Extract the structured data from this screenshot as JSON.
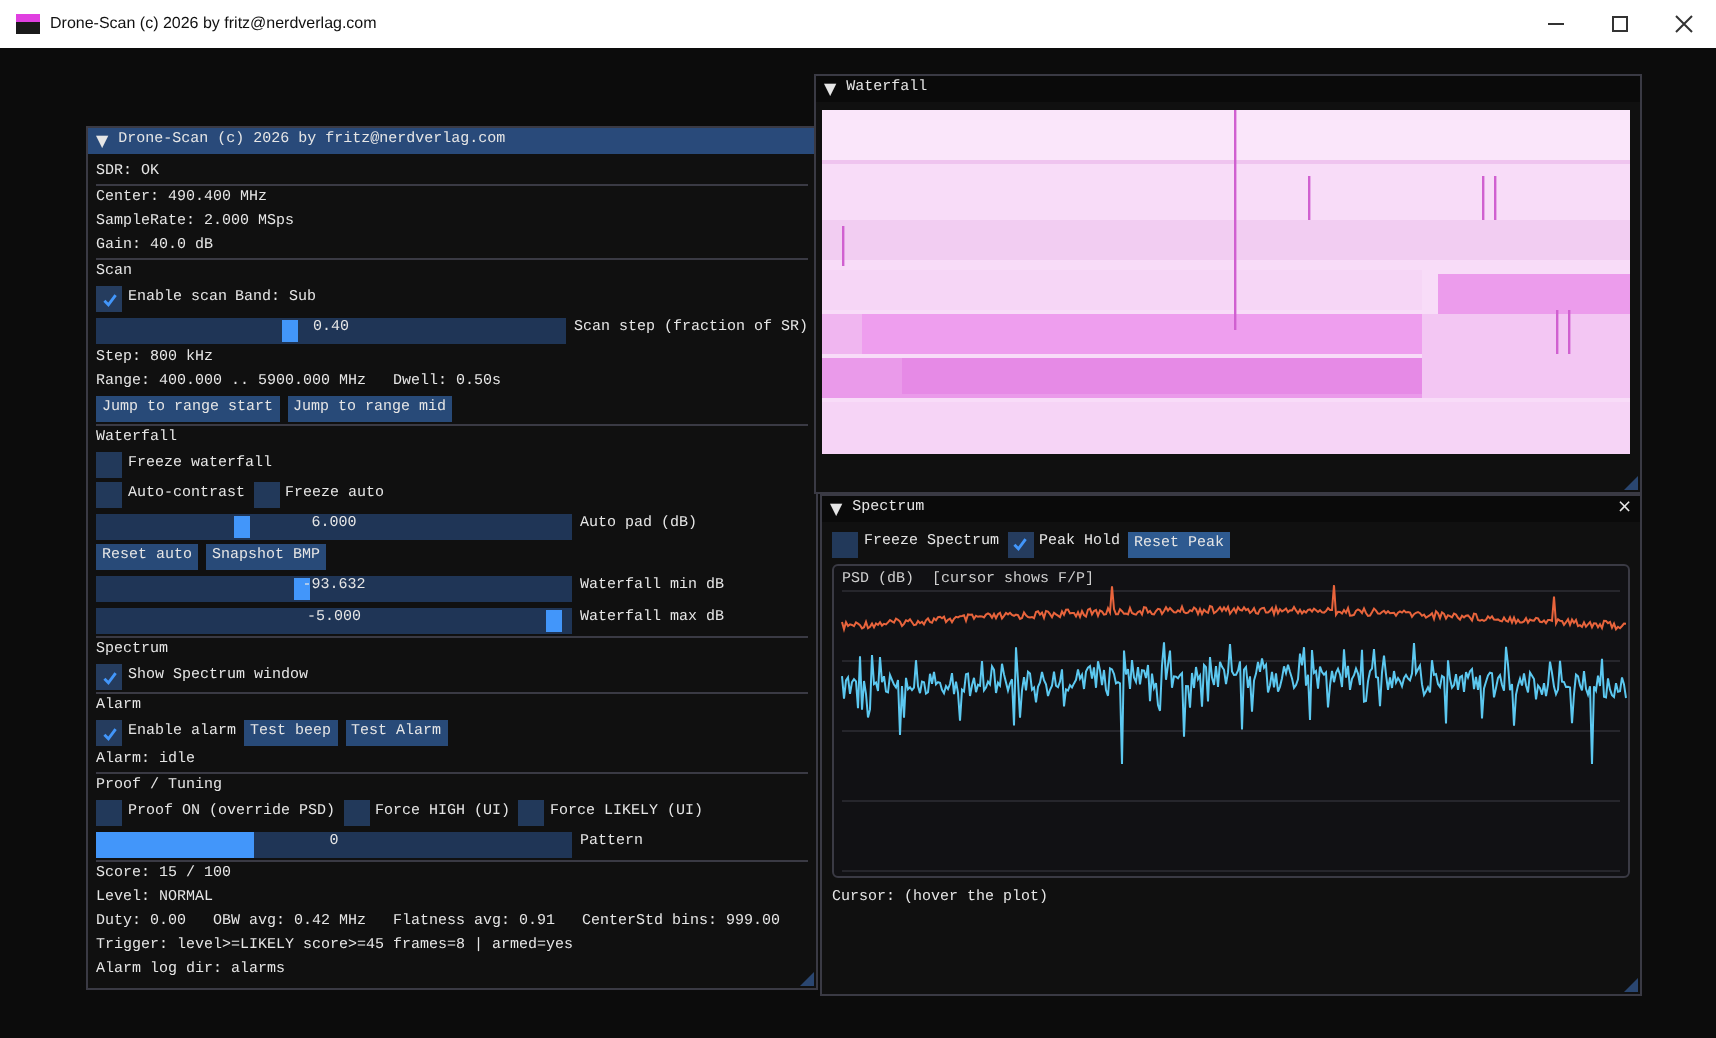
{
  "window": {
    "title": "Drone-Scan (c) 2026 by fritz@nerdverlag.com"
  },
  "control_panel": {
    "arrow": "▼",
    "title": "Drone-Scan (c) 2026 by fritz@nerdverlag.com",
    "items": [
      {
        "kind": "text",
        "text": "SDR: OK"
      },
      {
        "kind": "separator"
      },
      {
        "kind": "text",
        "text": "Center: 490.400 MHz"
      },
      {
        "kind": "text",
        "text": "SampleRate: 2.000 MSps"
      },
      {
        "kind": "text",
        "text": "Gain: 40.0 dB"
      },
      {
        "kind": "separator"
      },
      {
        "kind": "text",
        "text": "Scan"
      },
      {
        "kind": "row",
        "widgets": [
          {
            "kind": "checkbox",
            "label": "Enable scan",
            "checked": true
          },
          {
            "kind": "text",
            "text": "Band: Sub"
          }
        ]
      },
      {
        "kind": "slider",
        "value": "0.40",
        "label": "Scan step (fraction of SR)",
        "level": 0.41
      },
      {
        "kind": "text",
        "text": "Step: 800 kHz"
      },
      {
        "kind": "text",
        "text": "Range: 400.000 .. 5900.000 MHz   Dwell: 0.50s"
      },
      {
        "kind": "row",
        "widgets": [
          {
            "kind": "button",
            "label": "Jump to range start"
          },
          {
            "kind": "button",
            "label": "Jump to range mid"
          }
        ]
      },
      {
        "kind": "separator"
      },
      {
        "kind": "text",
        "text": "Waterfall"
      },
      {
        "kind": "row",
        "widgets": [
          {
            "kind": "checkbox",
            "label": "Freeze waterfall",
            "checked": false
          }
        ]
      },
      {
        "kind": "row",
        "widgets": [
          {
            "kind": "checkbox",
            "label": "Auto-contrast",
            "checked": false
          },
          {
            "kind": "checkbox",
            "label": "Freeze auto",
            "checked": false
          }
        ]
      },
      {
        "kind": "slider",
        "value": "6.000",
        "label": "Auto pad (dB)",
        "level": 0.3
      },
      {
        "kind": "row",
        "widgets": [
          {
            "kind": "button",
            "label": "Reset auto"
          },
          {
            "kind": "button",
            "label": "Snapshot BMP"
          }
        ]
      },
      {
        "kind": "slider",
        "value": "-93.632",
        "label": "Waterfall min dB",
        "level": 0.43
      },
      {
        "kind": "slider",
        "value": "-5.000",
        "label": "Waterfall max dB",
        "level": 0.98
      },
      {
        "kind": "separator"
      },
      {
        "kind": "text",
        "text": "Spectrum"
      },
      {
        "kind": "row",
        "widgets": [
          {
            "kind": "checkbox",
            "label": "Show Spectrum window",
            "checked": true
          }
        ]
      },
      {
        "kind": "separator"
      },
      {
        "kind": "text",
        "text": "Alarm"
      },
      {
        "kind": "row",
        "widgets": [
          {
            "kind": "checkbox",
            "label": "Enable alarm",
            "checked": true
          },
          {
            "kind": "button",
            "label": "Test beep"
          },
          {
            "kind": "button",
            "label": "Test Alarm"
          }
        ]
      },
      {
        "kind": "text",
        "text": "Alarm: idle"
      },
      {
        "kind": "separator"
      },
      {
        "kind": "text",
        "text": "Proof / Tuning"
      },
      {
        "kind": "row",
        "widgets": [
          {
            "kind": "checkbox",
            "label": "Proof ON (override PSD)",
            "checked": false
          },
          {
            "kind": "checkbox",
            "label": "Force HIGH (UI)",
            "checked": false
          },
          {
            "kind": "checkbox",
            "label": "Force LIKELY (UI)",
            "checked": false
          }
        ]
      },
      {
        "kind": "progress",
        "value": "0",
        "label": "Pattern",
        "level": 0.33
      },
      {
        "kind": "separator"
      },
      {
        "kind": "text",
        "text": "Score: 15 / 100"
      },
      {
        "kind": "text",
        "text": "Level: NORMAL"
      },
      {
        "kind": "text",
        "text": "Duty: 0.00   OBW avg: 0.42 MHz   Flatness avg: 0.91   CenterStd bins: 999.00"
      },
      {
        "kind": "text",
        "text": "Trigger: level>=LIKELY score>=45 frames=8 | armed=yes"
      },
      {
        "kind": "text",
        "text": "Alarm log dir: alarms"
      }
    ]
  },
  "waterfall_window": {
    "arrow": "▼",
    "title": "Waterfall"
  },
  "spectrum_window": {
    "arrow": "▼",
    "title": "Spectrum",
    "close": "×",
    "controls": [
      {
        "kind": "checkbox",
        "label": "Freeze Spectrum",
        "checked": false
      },
      {
        "kind": "checkbox",
        "label": "Peak Hold",
        "checked": true
      },
      {
        "kind": "button",
        "label": "Reset Peak"
      }
    ],
    "plot_title": "PSD (dB)  [cursor shows F/P]",
    "cursor_text": "Cursor: (hover the plot)"
  }
}
